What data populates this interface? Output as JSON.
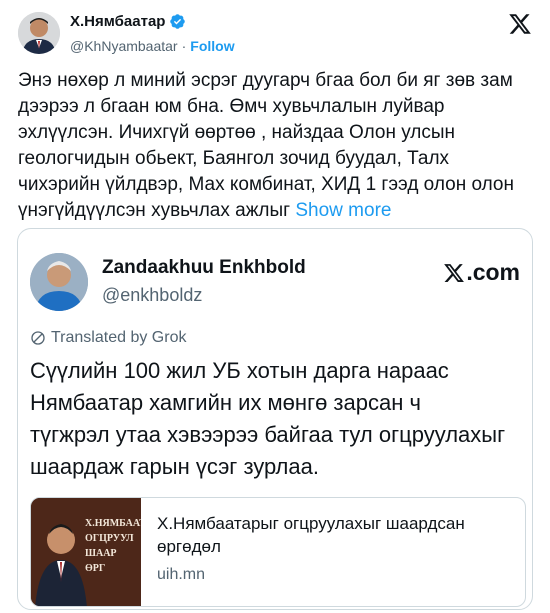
{
  "author": {
    "name": "Х.Нямбаатар",
    "handle": "@KhNyambaatar",
    "separator": "·",
    "follow_label": "Follow"
  },
  "tweet": {
    "text": "Энэ нөхөр л миний эсрэг дуугарч бгаа бол би яг зөв зам дээрээ л бгаан юм бна. Өмч хувьчлалын луйвар эхлүүлсэн. Ичихгүй өөртөө , найздаа Олон улсын геологчидын обьект, Баянгол зочид буудал, Талх чихэрийн үйлдвэр, Мах комбинат, ХИД 1 гээд олон олон үнэгүйдүүлсэн хувьчлах ажлыг",
    "show_more_label": "Show more"
  },
  "quote": {
    "name": "Zandaakhuu Enkhbold",
    "handle": "@enkhboldz",
    "source_label": ".com",
    "translated_label": "Translated by Grok",
    "text_lines": [
      "Сүүлийн 100 жил УБ хотын дарга нараас",
      "Нямбаатар хамгийн их мөнгө зарсан ч",
      "түгжрэл утаа хэвээрээ байгаа тул огцруулахыг",
      "шаардаж гарын үсэг зурлаа."
    ],
    "link_card": {
      "title": "Х.Нямбаатарыг огцруулахыг шаардсан өргөдөл",
      "domain": "uih.mn",
      "thumb_lines": [
        "Х.НЯМБААТ",
        "ОГЦРУУЛ",
        "ШААР",
        "ӨРГ"
      ]
    }
  },
  "colors": {
    "link_blue": "#1d9bf0",
    "verified_blue": "#1d9bf0",
    "text": "#0f1419",
    "muted": "#536471",
    "border": "#cfd9de"
  },
  "icons": [
    "verified-badge-icon",
    "x-logo-icon",
    "translate-icon"
  ]
}
